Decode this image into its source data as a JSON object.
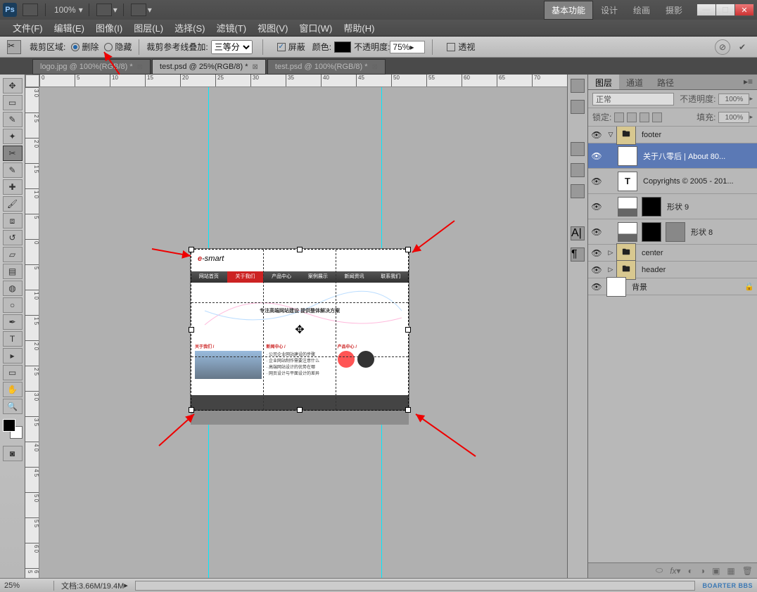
{
  "app": {
    "logo": "Ps",
    "zoom_top": "100%"
  },
  "workspaces": {
    "basic": "基本功能",
    "design": "设计",
    "paint": "绘画",
    "photo": "摄影"
  },
  "window_buttons": {
    "min": "—",
    "max": "☐",
    "close": "✕"
  },
  "menu": {
    "file": "文件(F)",
    "edit": "编辑(E)",
    "image": "图像(I)",
    "layer": "图层(L)",
    "select": "选择(S)",
    "filter": "滤镜(T)",
    "view": "视图(V)",
    "window": "窗口(W)",
    "help": "帮助(H)"
  },
  "options": {
    "crop_area_label": "裁剪区域:",
    "delete": "删除",
    "hide": "隐藏",
    "guide_label": "裁剪参考线叠加:",
    "guide_value": "三等分",
    "shield": "屏蔽",
    "color_label": "颜色:",
    "color_value": "#000000",
    "opacity_label": "不透明度:",
    "opacity_value": "75%",
    "perspective": "透视"
  },
  "tabs": [
    {
      "label": "logo.jpg @ 100%(RGB/8) *"
    },
    {
      "label": "test.psd @ 25%(RGB/8) *"
    },
    {
      "label": "test.psd @ 100%(RGB/8) *"
    }
  ],
  "ruler_h": [
    "0",
    "5",
    "10",
    "15",
    "20",
    "25",
    "30",
    "35",
    "40",
    "45",
    "50",
    "55",
    "60",
    "65",
    "70"
  ],
  "ruler_v": [
    "3 0",
    "2 5",
    "2 0",
    "1 5",
    "1 0",
    "5",
    "0",
    "5",
    "1 0",
    "1 5",
    "2 0",
    "2 5",
    "3 0",
    "3 5",
    "4 0",
    "4 5",
    "5 0",
    "5 5",
    "6 0",
    "6 5"
  ],
  "doc": {
    "logo_e": "e",
    "logo_rest": "-smart",
    "nav": [
      "网站首页",
      "关于我们",
      "产品中心",
      "案例展示",
      "新闻资讯",
      "联系我们"
    ],
    "body_text": "专注高端网站建设 提供整体解决方案",
    "cols": [
      {
        "h": "关于我们 /",
        "lines": [
          "",
          "",
          "",
          ""
        ]
      },
      {
        "h": "新闻中心 /",
        "lines": [
          "· 公司企业网站建设的步骤",
          "· 企业网站制作需要注意什么",
          "· 高端网站设计的优势在哪",
          "· 网页设计与平面设计的差异"
        ]
      },
      {
        "h": "产品中心 /",
        "lines": [
          "",
          "",
          ""
        ]
      }
    ]
  },
  "panel": {
    "tabs": {
      "layers": "图层",
      "channels": "通道",
      "paths": "路径"
    },
    "blend_label": "正常",
    "opacity_label": "不透明度:",
    "opacity_value": "100%",
    "lock_label": "锁定:",
    "fill_label": "填充:",
    "fill_value": "100%"
  },
  "layers": [
    {
      "type": "group",
      "name": "footer",
      "open": true
    },
    {
      "type": "text",
      "name": "关于八零后  |  About 80...",
      "selected": true,
      "indent": 1
    },
    {
      "type": "text",
      "name": "Copyrights © 2005 - 201...",
      "indent": 1
    },
    {
      "type": "shape",
      "name": "形状 9",
      "indent": 1
    },
    {
      "type": "shape2",
      "name": "形状 8",
      "indent": 1
    },
    {
      "type": "group",
      "name": "center",
      "open": false
    },
    {
      "type": "group",
      "name": "header",
      "open": false
    },
    {
      "type": "bg",
      "name": "背景",
      "locked": true
    }
  ],
  "status": {
    "zoom": "25%",
    "doc_info": "文档:3.66M/19.4M",
    "watermark": "BOARTER BBS"
  }
}
